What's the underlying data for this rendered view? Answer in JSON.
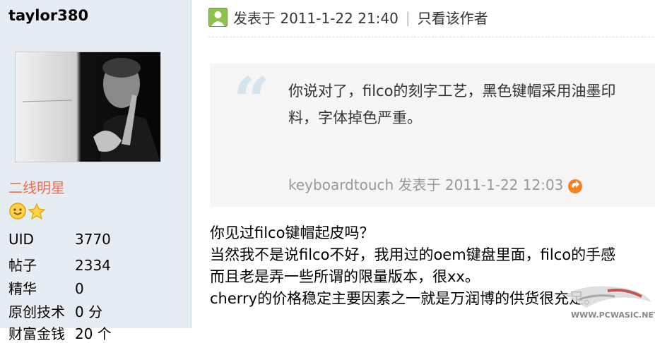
{
  "author": {
    "username": "taylor380",
    "rank": "二线明星",
    "stats": [
      {
        "label": "UID",
        "value": "3770"
      },
      {
        "label": "帖子",
        "value": "2334"
      },
      {
        "label": "精华",
        "value": "0"
      },
      {
        "label": "原创技术",
        "value": "0 分"
      },
      {
        "label": "财富金钱",
        "value": "20 个"
      }
    ]
  },
  "post": {
    "posted_label": "发表于 2011-1-22 21:40",
    "separator": "|",
    "author_only_link": "只看该作者",
    "quote": {
      "line1": "你说对了，filco的刻字工艺，黑色键帽采用油墨印",
      "line2": "料，字体掉色严重。",
      "source": "keyboardtouch 发表于 2011-1-22 12:03"
    },
    "body_lines": [
      "你见过filco键帽起皮吗？",
      "当然我不是说filco不好，我用过的oem键盘里面，filco的手感",
      "而且老是弄一些所谓的限量版本，很xx。",
      "cherry的价格稳定主要因素之一就是万润博的供货很充足。"
    ]
  },
  "watermark": {
    "text": "WWW.PCWASIC.NET"
  },
  "colors": {
    "sidebar_bg": "#e5edf2",
    "rank": "#f26c4f",
    "quote_bg": "#f5f5f5",
    "muted": "#999999",
    "online_icon": "#8bc34a"
  }
}
